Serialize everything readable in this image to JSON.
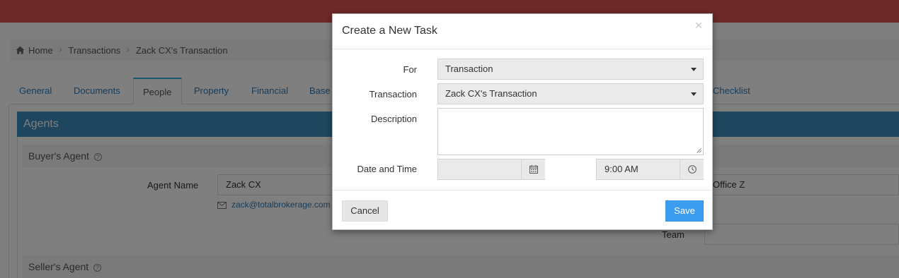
{
  "colors": {
    "topbar": "#d9534f",
    "tab_link": "#2a7ab9",
    "agents_header": "#3c8dbc",
    "save_button": "#3c9cf0"
  },
  "breadcrumb": {
    "home": "Home",
    "transactions": "Transactions",
    "current": "Zack CX's Transaction"
  },
  "tabs": [
    {
      "label": "General"
    },
    {
      "label": "Documents"
    },
    {
      "label": "People"
    },
    {
      "label": "Property"
    },
    {
      "label": "Financial"
    },
    {
      "label": "Base"
    },
    {
      "label": "Checklist"
    }
  ],
  "agents": {
    "title": "Agents",
    "buyers_agent": "Buyer's Agent",
    "sellers_agent": "Seller's Agent",
    "agent_name_label": "Agent Name",
    "agent_name_value": "Zack CX",
    "agent_email": "zack@totalbrokerage.com",
    "office_value": "Office Z",
    "team_label": "Team"
  },
  "modal": {
    "title": "Create a New Task",
    "close": "×",
    "for_label": "For",
    "for_value": "Transaction",
    "transaction_label": "Transaction",
    "transaction_value": "Zack CX's Transaction",
    "description_label": "Description",
    "description_value": "",
    "date_time_label": "Date and Time",
    "date_value": "",
    "time_value": "9:00 AM",
    "cancel": "Cancel",
    "save": "Save"
  },
  "icons": {
    "home": "home-icon",
    "calendar": "calendar-icon",
    "clock": "clock-icon",
    "envelope": "envelope-icon",
    "help": "question-circle-icon",
    "caret": "caret-down-icon",
    "close": "close-icon"
  }
}
